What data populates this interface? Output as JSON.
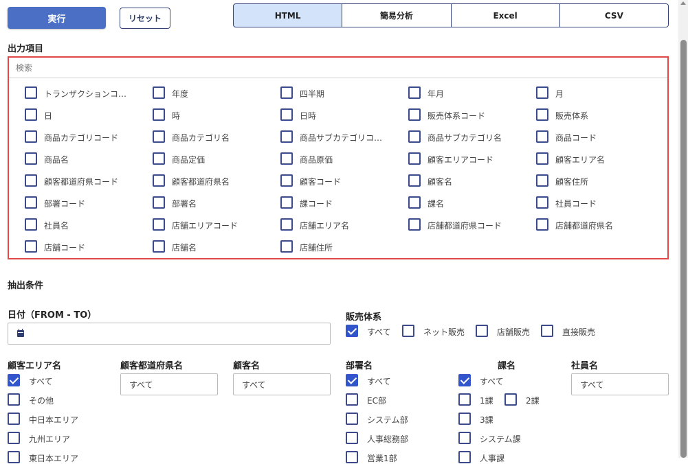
{
  "toolbar": {
    "run_label": "実行",
    "reset_label": "リセット"
  },
  "tabs": [
    "HTML",
    "簡易分析",
    "Excel",
    "CSV"
  ],
  "output": {
    "title": "出力項目",
    "search_placeholder": "検索",
    "items": [
      "トランザクションコ…",
      "年度",
      "四半期",
      "年月",
      "月",
      "日",
      "時",
      "日時",
      "販売体系コード",
      "販売体系",
      "商品カテゴリコード",
      "商品カテゴリ名",
      "商品サブカテゴリコ…",
      "商品サブカテゴリ名",
      "商品コード",
      "商品名",
      "商品定価",
      "商品原価",
      "顧客エリアコード",
      "顧客エリア名",
      "顧客都道府県コード",
      "顧客都道府県名",
      "顧客コード",
      "顧客名",
      "顧客住所",
      "部署コード",
      "部署名",
      "課コード",
      "課名",
      "社員コード",
      "社員名",
      "店舗エリアコード",
      "店舗エリア名",
      "店舗都道府県コード",
      "店舗都道府県名",
      "店舗コード",
      "店舗名",
      "店舗住所"
    ]
  },
  "conditions": {
    "title": "抽出条件",
    "date": {
      "label": "日付（FROM - TO）",
      "value": ""
    },
    "sales_type": {
      "label": "販売体系",
      "options": [
        {
          "label": "すべて",
          "checked": true
        },
        {
          "label": "ネット販売",
          "checked": false
        },
        {
          "label": "店舗販売",
          "checked": false
        },
        {
          "label": "直接販売",
          "checked": false
        }
      ]
    },
    "customer_area": {
      "label": "顧客エリア名",
      "options": [
        {
          "label": "すべて",
          "checked": true
        },
        {
          "label": "その他",
          "checked": false
        },
        {
          "label": "中日本エリア",
          "checked": false
        },
        {
          "label": "九州エリア",
          "checked": false
        },
        {
          "label": "東日本エリア",
          "checked": false
        }
      ]
    },
    "customer_pref": {
      "label": "顧客都道府県名",
      "value": "すべて"
    },
    "customer_name": {
      "label": "顧客名",
      "value": "すべて"
    },
    "department": {
      "label": "部署名",
      "options": [
        {
          "label": "すべて",
          "checked": true
        },
        {
          "label": "EC部",
          "checked": false
        },
        {
          "label": "システム部",
          "checked": false
        },
        {
          "label": "人事総務部",
          "checked": false
        },
        {
          "label": "営業1部",
          "checked": false
        }
      ]
    },
    "section": {
      "label": "課名",
      "options": [
        {
          "label": "すべて",
          "checked": true
        },
        {
          "label": "1課",
          "checked": false
        },
        {
          "label": "2課",
          "checked": false
        },
        {
          "label": "3課",
          "checked": false
        },
        {
          "label": "システム課",
          "checked": false
        },
        {
          "label": "人事課",
          "checked": false
        }
      ]
    },
    "employee": {
      "label": "社員名",
      "value": "すべて"
    }
  }
}
